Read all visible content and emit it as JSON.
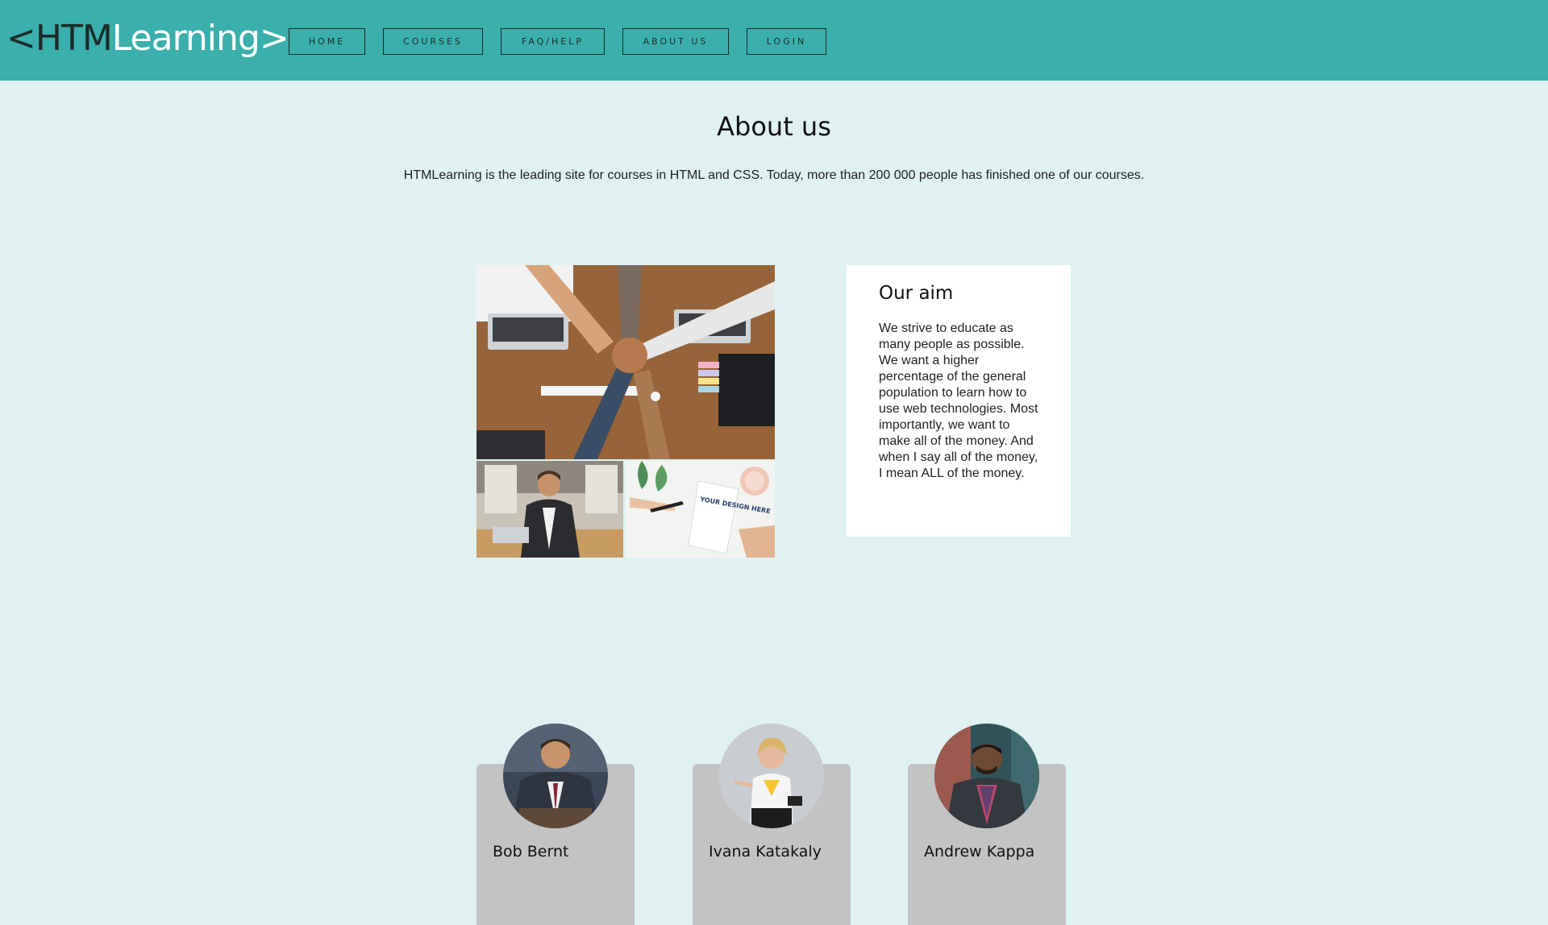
{
  "header": {
    "logo_prefix": "<HTM",
    "logo_suffix": "Learning>",
    "nav": [
      {
        "label": "HOME"
      },
      {
        "label": "COURSES"
      },
      {
        "label": "FAQ/HELP"
      },
      {
        "label": "ABOUT US"
      },
      {
        "label": "LOGIN"
      }
    ]
  },
  "about": {
    "title": "About us",
    "intro": "HTMLearning is the leading site for courses in HTML and CSS. Today, more than 200 000 people has finished one of our courses."
  },
  "aim": {
    "title": "Our aim",
    "text": "We strive to educate as many people as possible. We want a higher percentage of the general population to learn how to use web technologies. Most importantly, we want to make all of the money. And when I say all of the money, I mean ALL of the money."
  },
  "collage": {
    "notebook_text": "YOUR DESIGN HERE"
  },
  "team": [
    {
      "name": "Bob Bernt"
    },
    {
      "name": "Ivana Katakaly"
    },
    {
      "name": "Andrew Kappa"
    }
  ],
  "colors": {
    "header_bg": "#3aafac",
    "page_bg": "#dff2f1",
    "card_bg": "#ffffff",
    "member_card_bg": "#c3c3c3"
  }
}
